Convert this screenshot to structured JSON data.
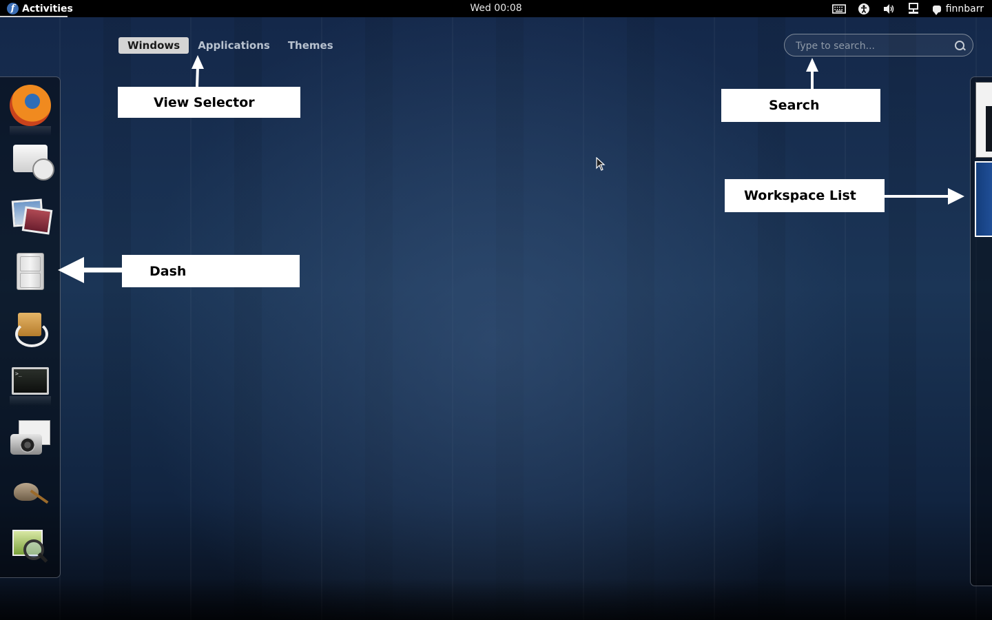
{
  "topbar": {
    "activities_label": "Activities",
    "clock": "Wed 00:08",
    "tray_icons": [
      "keyboard-icon",
      "accessibility-icon",
      "volume-icon",
      "network-icon"
    ],
    "user_name": "finnbarr"
  },
  "view_selector": {
    "tabs": [
      {
        "label": "Windows",
        "active": true
      },
      {
        "label": "Applications",
        "active": false
      },
      {
        "label": "Themes",
        "active": false
      }
    ]
  },
  "search": {
    "placeholder": "Type to search...",
    "value": ""
  },
  "dash": {
    "items": [
      {
        "name": "firefox-icon"
      },
      {
        "name": "evolution-mail-icon"
      },
      {
        "name": "photos-icon"
      },
      {
        "name": "file-cabinet-icon"
      },
      {
        "name": "software-update-icon"
      },
      {
        "name": "terminal-icon"
      },
      {
        "name": "screenshot-icon"
      },
      {
        "name": "gimp-icon"
      },
      {
        "name": "image-viewer-icon"
      }
    ]
  },
  "annotations": {
    "view_selector": "View Selector",
    "search": "Search",
    "workspace_list": "Workspace List",
    "dash": "Dash"
  },
  "colors": {
    "topbar": "#000000",
    "desktop": "#1b3556",
    "active_tab": "#d4d4d4",
    "label_bg": "#ffffff"
  }
}
